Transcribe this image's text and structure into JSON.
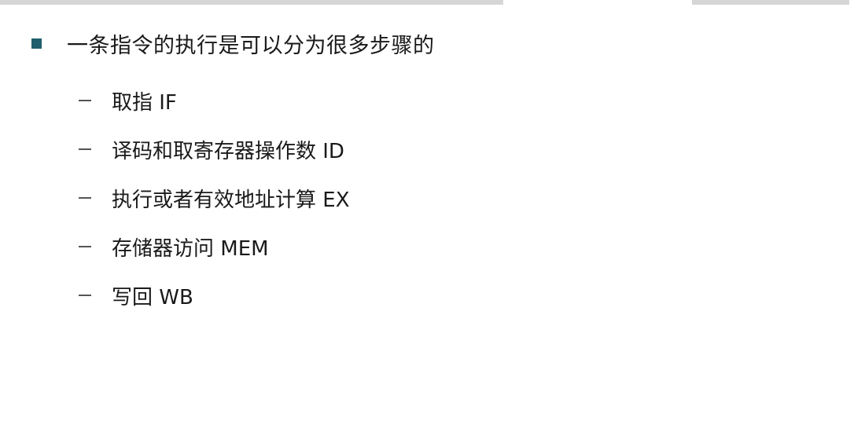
{
  "slide": {
    "main_bullet": "一条指令的执行是可以分为很多步骤的",
    "steps": [
      "取指 IF",
      "译码和取寄存器操作数 ID",
      "执行或者有效地址计算 EX",
      "存储器访问 MEM",
      "写回 WB"
    ],
    "colors": {
      "bullet_square": "#1f5f6b",
      "text": "#1a1a1a",
      "dash": "#555555"
    }
  }
}
